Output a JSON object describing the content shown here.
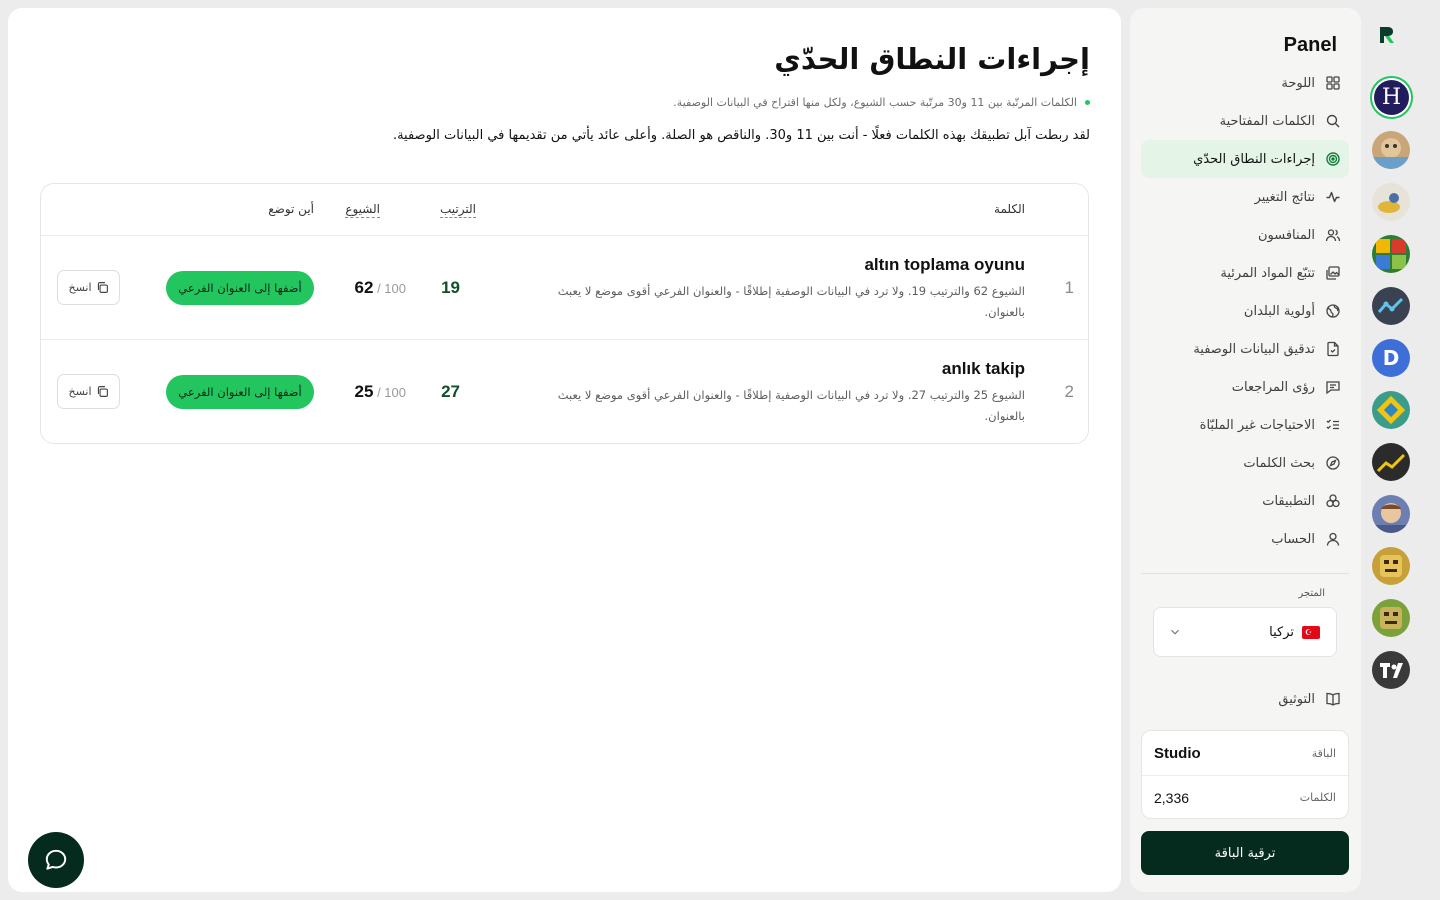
{
  "sidebar": {
    "title": "Panel",
    "items": [
      {
        "label": "اللوحة",
        "icon": "dashboard-icon"
      },
      {
        "label": "الكلمات المفتاحية",
        "icon": "search-icon"
      },
      {
        "label": "إجراءات النطاق الحدّي",
        "icon": "target-icon",
        "active": true
      },
      {
        "label": "نتائج التغيير",
        "icon": "activity-icon"
      },
      {
        "label": "المنافسون",
        "icon": "users-icon"
      },
      {
        "label": "تتبّع المواد المرئية",
        "icon": "images-icon"
      },
      {
        "label": "أولوية البلدان",
        "icon": "globe-icon"
      },
      {
        "label": "تدقيق البيانات الوصفية",
        "icon": "file-check-icon"
      },
      {
        "label": "رؤى المراجعات",
        "icon": "message-icon"
      },
      {
        "label": "الاحتياجات غير الملبّاة",
        "icon": "list-check-icon"
      },
      {
        "label": "بحث الكلمات",
        "icon": "compass-icon"
      },
      {
        "label": "التطبيقات",
        "icon": "apps-icon"
      },
      {
        "label": "الحساب",
        "icon": "user-icon"
      }
    ],
    "store_label": "المتجر",
    "store_value": "تركيا",
    "docs_label": "التوثيق",
    "plan_label": "الباقة",
    "plan_value": "Studio",
    "words_label": "الكلمات",
    "words_value": "2,336",
    "upgrade_label": "ترقية الباقة"
  },
  "rail": {
    "active_app_letter": "H",
    "accent": "#22c55e"
  },
  "main": {
    "title": "إجراءات النطاق الحدّي",
    "note": "الكلمات المرتّبة بين 11 و30 مرتّبة حسب الشيوع، ولكل منها اقتراح في البيانات الوصفية.",
    "description": "لقد ربطت آبل تطبيقك بهذه الكلمات فعلًا - أنت بين 11 و30. والناقص هو الصلة. وأعلى عائد يأتي من تقديمها في البيانات الوصفية.",
    "table": {
      "headers": {
        "keyword": "الكلمة",
        "rank": "الترتيب",
        "popularity": "الشيوع",
        "placement": "أين توضع"
      },
      "rows": [
        {
          "num": "1",
          "keyword": "altın toplama oyunu",
          "detail": "الشيوع 62 والترتيب 19. ولا ترد في البيانات الوصفية إطلاقًا - والعنوان الفرعي أقوى موضع لا يعبث بالعنوان.",
          "rank": "19",
          "popularity": "62",
          "popularity_max": "100",
          "action": "أضفها إلى العنوان الفرعي",
          "copy": "انسخ"
        },
        {
          "num": "2",
          "keyword": "anlık takip",
          "detail": "الشيوع 25 والترتيب 27. ولا ترد في البيانات الوصفية إطلاقًا - والعنوان الفرعي أقوى موضع لا يعبث بالعنوان.",
          "rank": "27",
          "popularity": "25",
          "popularity_max": "100",
          "action": "أضفها إلى العنوان الفرعي",
          "copy": "انسخ"
        }
      ]
    }
  }
}
